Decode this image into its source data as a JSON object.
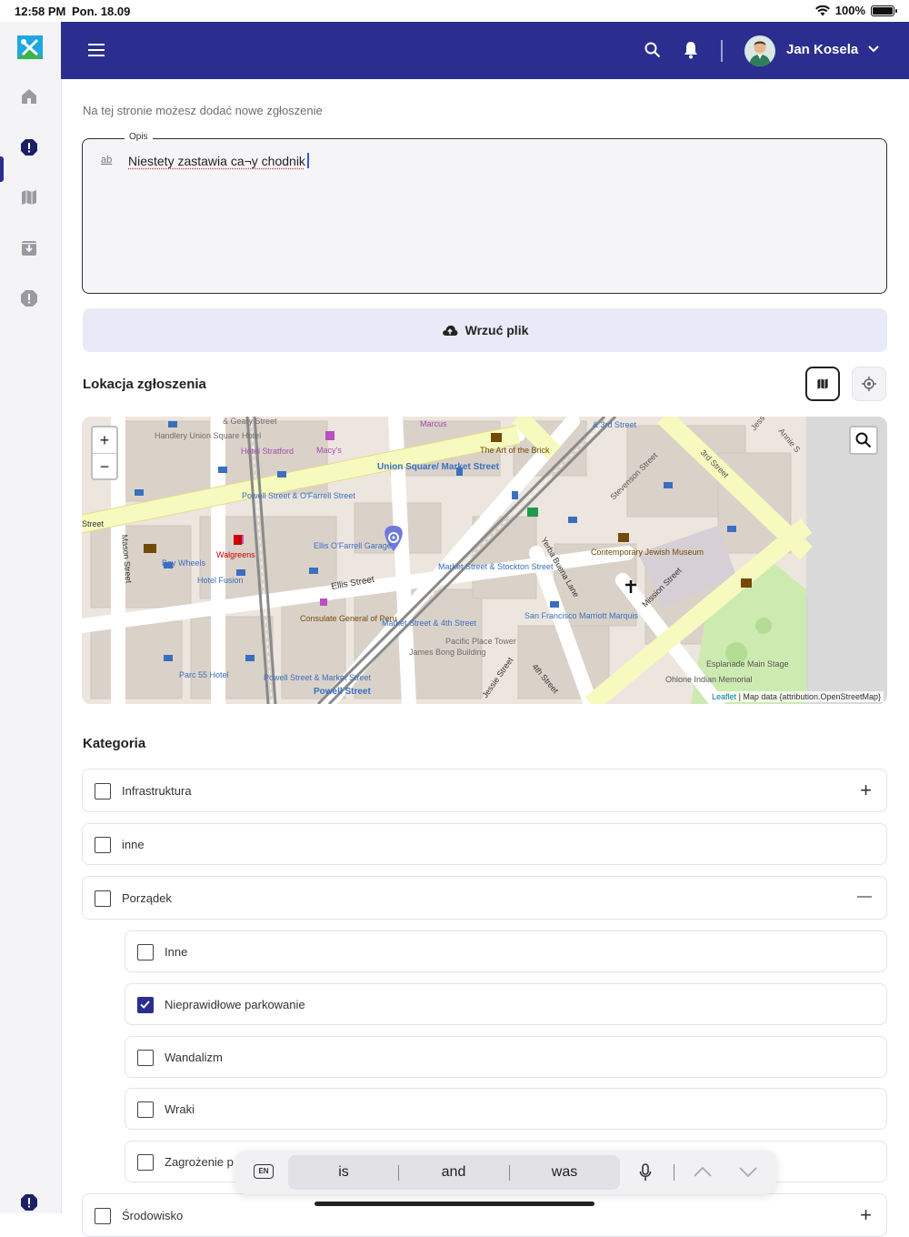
{
  "status_bar": {
    "time": "12:58 PM",
    "date": "Pon. 18.09",
    "battery": "100%"
  },
  "header": {
    "user_name": "Jan Kosela"
  },
  "page": {
    "subtitle": "Na tej stronie możesz dodać nowe zgłoszenie",
    "description": {
      "label": "Opis",
      "value": "Niestety zastawia ca¬y chodnik"
    },
    "upload_label": "Wrzuć plik",
    "location_title": "Lokacja zgłoszenia",
    "category_title": "Kategoria"
  },
  "map": {
    "attribution_leaflet": "Leaflet",
    "attribution_text": "| Map data {attribution.OpenStreetMap}",
    "labels": [
      "Handlery Union Square Hotel",
      "& Geary Street",
      "Hotel Stratford",
      "Macy's",
      "Marcus",
      "& 3rd Street",
      "The Art of the Brick",
      "Union Square/ Market Street",
      "Powell Street & O'Farrell Street",
      "Stevenson Street",
      "3rd Street",
      "Walgreens",
      "Ellis O'Farrell Garage",
      "Bay Wheels",
      "Hotel Fusion",
      "Ellis Street",
      "Mason Street",
      "Yerba Buena Lane",
      "Contemporary Jewish Museum",
      "Market Street & Stockton Street",
      "Mission Street",
      "Consulate General of Peru",
      "Market Street & 4th Street",
      "Pacific Place Tower",
      "San Francisco Marriott Marquis",
      "James Bong Building",
      "Parc 55 Hotel",
      "Powell Street & Market Street",
      "Powell Street",
      "Jessie Street",
      "4th Street",
      "Esplanade Main Stage",
      "Ohlone Indian Memorial",
      "Street",
      "Annie S",
      "Jess"
    ]
  },
  "categories": [
    {
      "label": "Infrastruktura",
      "checked": false,
      "toggle": "+"
    },
    {
      "label": "inne",
      "checked": false,
      "toggle": ""
    },
    {
      "label": "Porządek",
      "checked": false,
      "toggle": "—"
    },
    {
      "label": "Inne",
      "checked": false,
      "toggle": ""
    },
    {
      "label": "Nieprawidłowe parkowanie",
      "checked": true,
      "toggle": ""
    },
    {
      "label": "Wandalizm",
      "checked": false,
      "toggle": ""
    },
    {
      "label": "Wraki",
      "checked": false,
      "toggle": ""
    },
    {
      "label": "Zagrożenie p",
      "checked": false,
      "toggle": ""
    },
    {
      "label": "Środowisko",
      "checked": false,
      "toggle": "+"
    }
  ],
  "keyboard": {
    "lang": "EN",
    "suggestions": [
      "is",
      "and",
      "was"
    ]
  },
  "colors": {
    "primary": "#2b2e8f",
    "sidebar_bg": "#f4f4f6",
    "upload_bg": "#e9eaf7"
  },
  "icons": [
    "menu-icon",
    "search-icon",
    "bell-icon",
    "chevron-down-icon",
    "home-icon",
    "alert-icon",
    "map-icon",
    "download-icon",
    "cloud-upload-icon",
    "locate-icon",
    "microphone-icon",
    "chevron-up-icon"
  ]
}
